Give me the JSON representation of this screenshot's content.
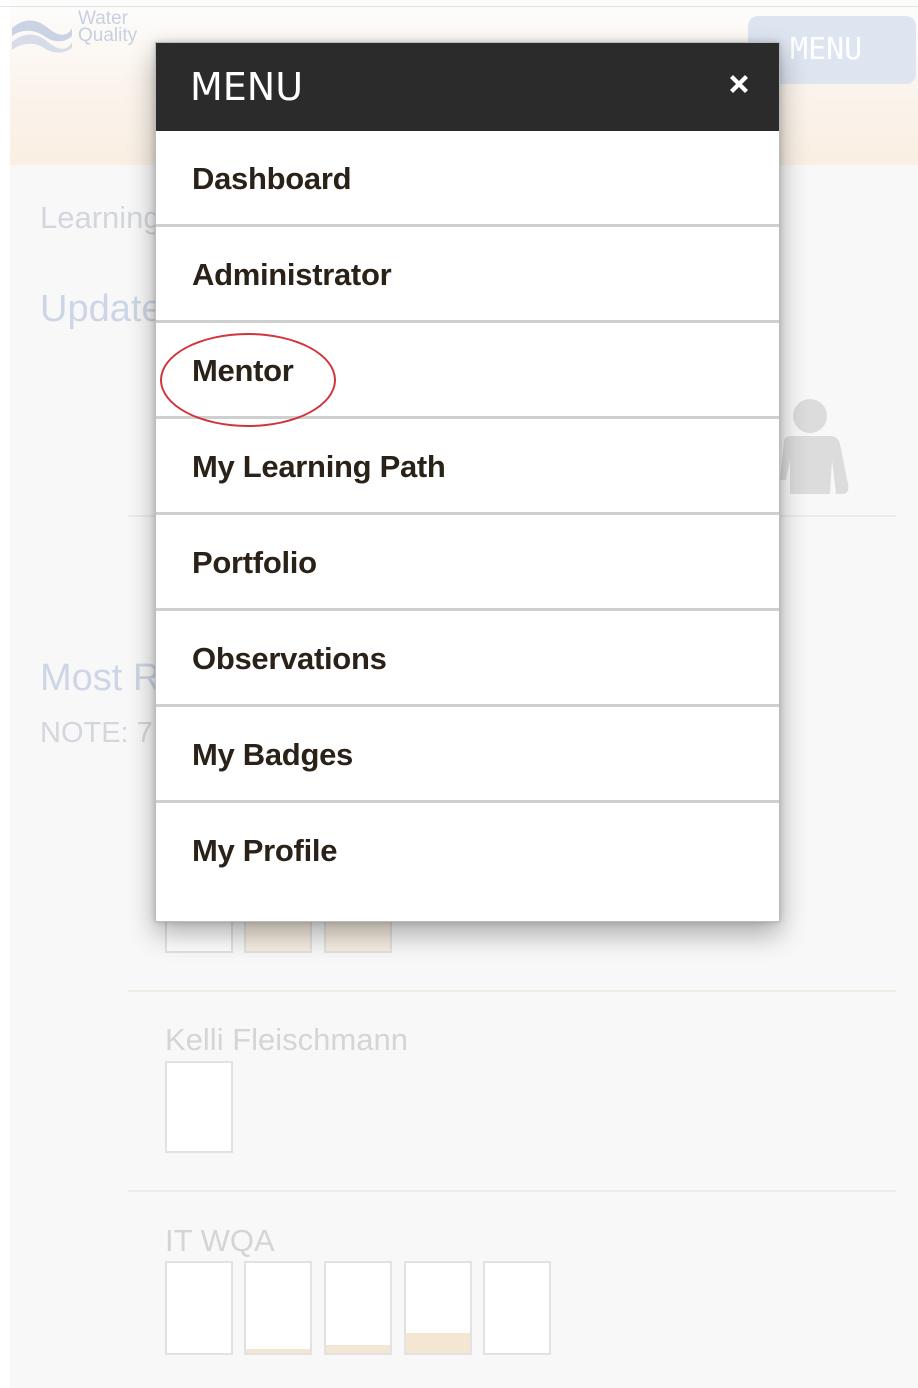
{
  "background": {
    "logo": {
      "line1": "Water",
      "line2": "Quality"
    },
    "menu_button_label": "MENU",
    "learning_heading": "Learning",
    "updates_heading": "Updates",
    "most_recent_heading": "Most R",
    "note_text": "NOTE: 7",
    "sections": [
      {
        "name": "Kelli Fleischmann"
      },
      {
        "name": "IT WQA"
      }
    ]
  },
  "menu": {
    "title": "MENU",
    "close_icon": "close-icon",
    "items": [
      {
        "label": "Dashboard"
      },
      {
        "label": "Administrator"
      },
      {
        "label": "Mentor",
        "highlighted": true
      },
      {
        "label": "My Learning Path"
      },
      {
        "label": "Portfolio"
      },
      {
        "label": "Observations"
      },
      {
        "label": "My Badges"
      },
      {
        "label": "My Profile"
      }
    ]
  },
  "colors": {
    "menu_header_bg": "#2b2b2b",
    "highlight_ring": "#d0353c",
    "menu_text": "#2a2218"
  }
}
